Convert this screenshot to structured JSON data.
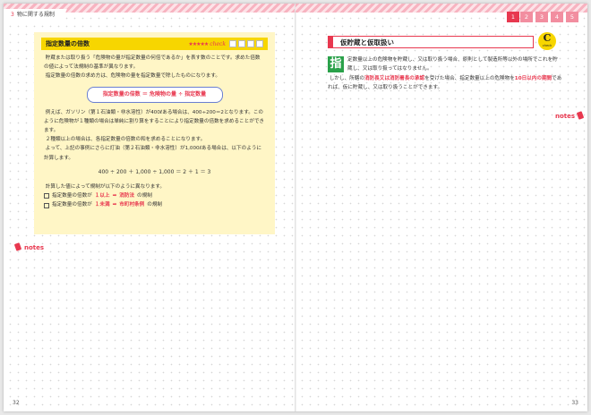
{
  "header": {
    "chapter_number": "3",
    "chapter_title": "物に関する規制",
    "tabs": [
      "1",
      "2",
      "3",
      "4",
      "5"
    ]
  },
  "left": {
    "box": {
      "title": "指定数量の倍数",
      "stars": "★★★★★",
      "check_word": "check",
      "para1": "貯蔵または取り扱う「危険物の量が指定数量の何倍であるか」を表す数のことです。求めた倍数の値によって法規制の基準が異なります。",
      "para2": "指定数量の倍数の求め方は、危険物の量を指定数量で除したものになります。",
      "formula": "指定数量の倍数 ＝ 危険物の量 ÷ 指定数量",
      "para3": "例えば、ガソリン（第１石油類・非水溶性）が400ℓある場合は、400÷200＝2となります。このように危険物が１種類の場合は単純に割り算をすることにより指定数量の倍数を求めることができます。",
      "para4": "２種類以上の場合は、各指定数量の倍数の和を求めることになります。",
      "para5": "よって、上記の事例にさらに灯油（第２石油類・非水溶性）が1,000ℓある場合は、以下のように計算します。",
      "calc": "400 ÷ 200 ＋ 1,000 ÷ 1,000 ＝ 2 ＋ 1 ＝ 3",
      "para6": "計算した値によって規制が以下のように異なります。",
      "bullet1_a": "指定数量の倍数が",
      "bullet1_b": "１以上",
      "bullet1_c": "消防法",
      "bullet1_d": "の規制",
      "bullet2_a": "指定数量の倍数が",
      "bullet2_b": "１未満",
      "bullet2_c": "市町村条例",
      "bullet2_d": "の規制"
    },
    "notes_label": "notes",
    "page_number": "32"
  },
  "right": {
    "section_title": "仮貯蔵と仮取扱い",
    "check_badge_letter": "C",
    "check_badge_word": "check",
    "kanji_mark": "指",
    "text1": "定数量以上の危険物を貯蔵し、又は取り扱う場合、原則として製造所等以外の場所でこれを貯蔵し、又は取り扱ってはなりません。",
    "text2_a": "しかし、所轄の",
    "text2_b": "消防長又は消防署長の承認",
    "text2_c": "を受けた場合、指定数量以上の危険物を",
    "text2_d": "10日以内の期間",
    "text2_e": "であれば、仮に貯蔵し、又は取り扱うことができます。",
    "notes_label": "notes",
    "page_number": "33"
  }
}
